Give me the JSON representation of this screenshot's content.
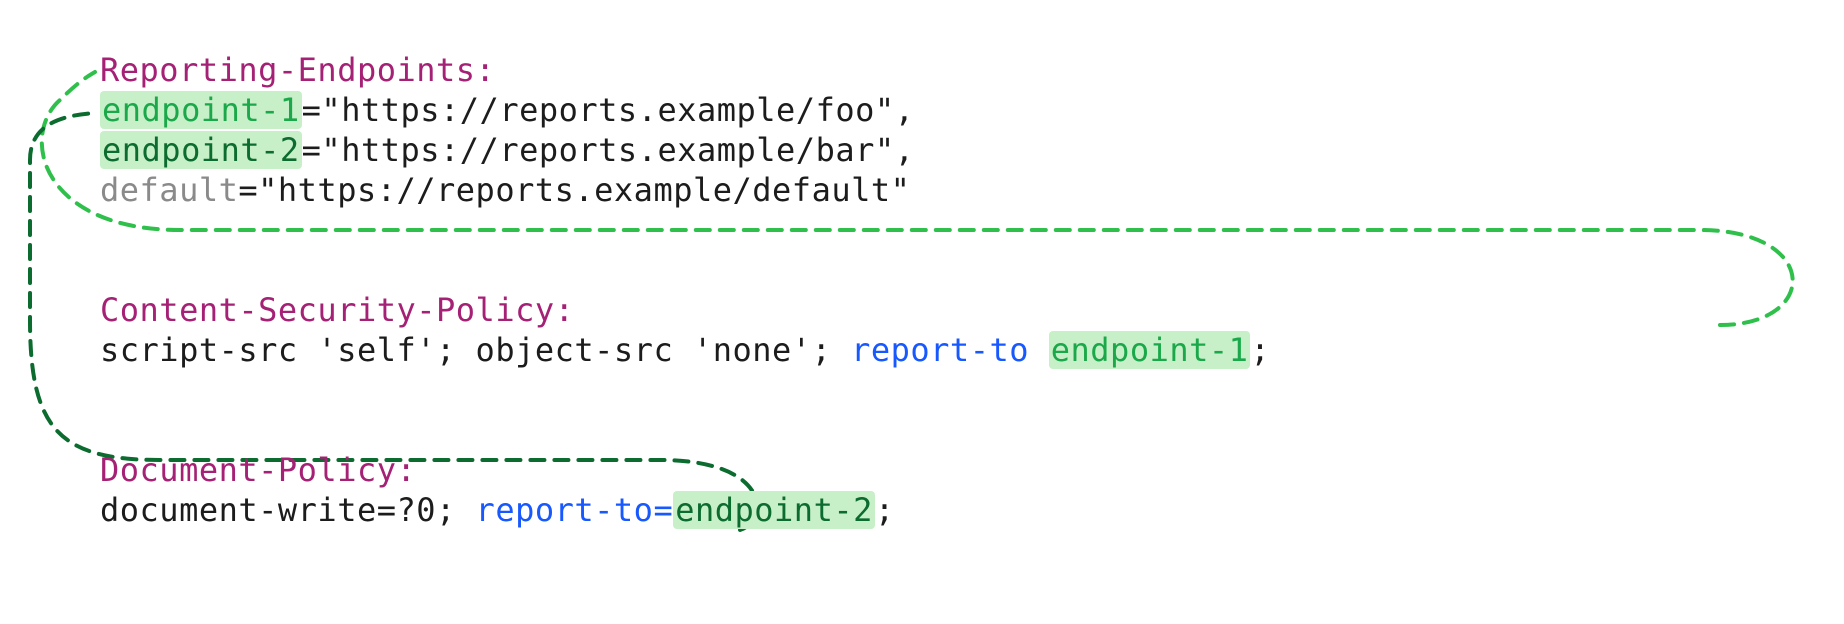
{
  "headers": {
    "reporting": {
      "name": "Reporting-Endpoints:",
      "e1": {
        "key": "endpoint-1",
        "eq": "=",
        "val": "\"https://reports.example/foo\"",
        "trail": ","
      },
      "e2": {
        "key": "endpoint-2",
        "eq": "=",
        "val": "\"https://reports.example/bar\"",
        "trail": ","
      },
      "e3": {
        "key": "default",
        "eq": "=",
        "val": "\"https://reports.example/default\""
      }
    },
    "csp": {
      "name": "Content-Security-Policy:",
      "body1": "script-src 'self'; object-src 'none'; ",
      "report_to": "report-to ",
      "target": "endpoint-1",
      "trail": ";"
    },
    "dp": {
      "name": "Document-Policy:",
      "body1": "document-write=?0; ",
      "report_to": "report-to=",
      "target": "endpoint-2",
      "trail": ";"
    }
  },
  "colors": {
    "header": "#A52175",
    "reportTo": "#1758ff",
    "hlBg": "#c8f0c8",
    "arrow1": "#2fbf4b",
    "arrow2": "#0c6b2e"
  }
}
